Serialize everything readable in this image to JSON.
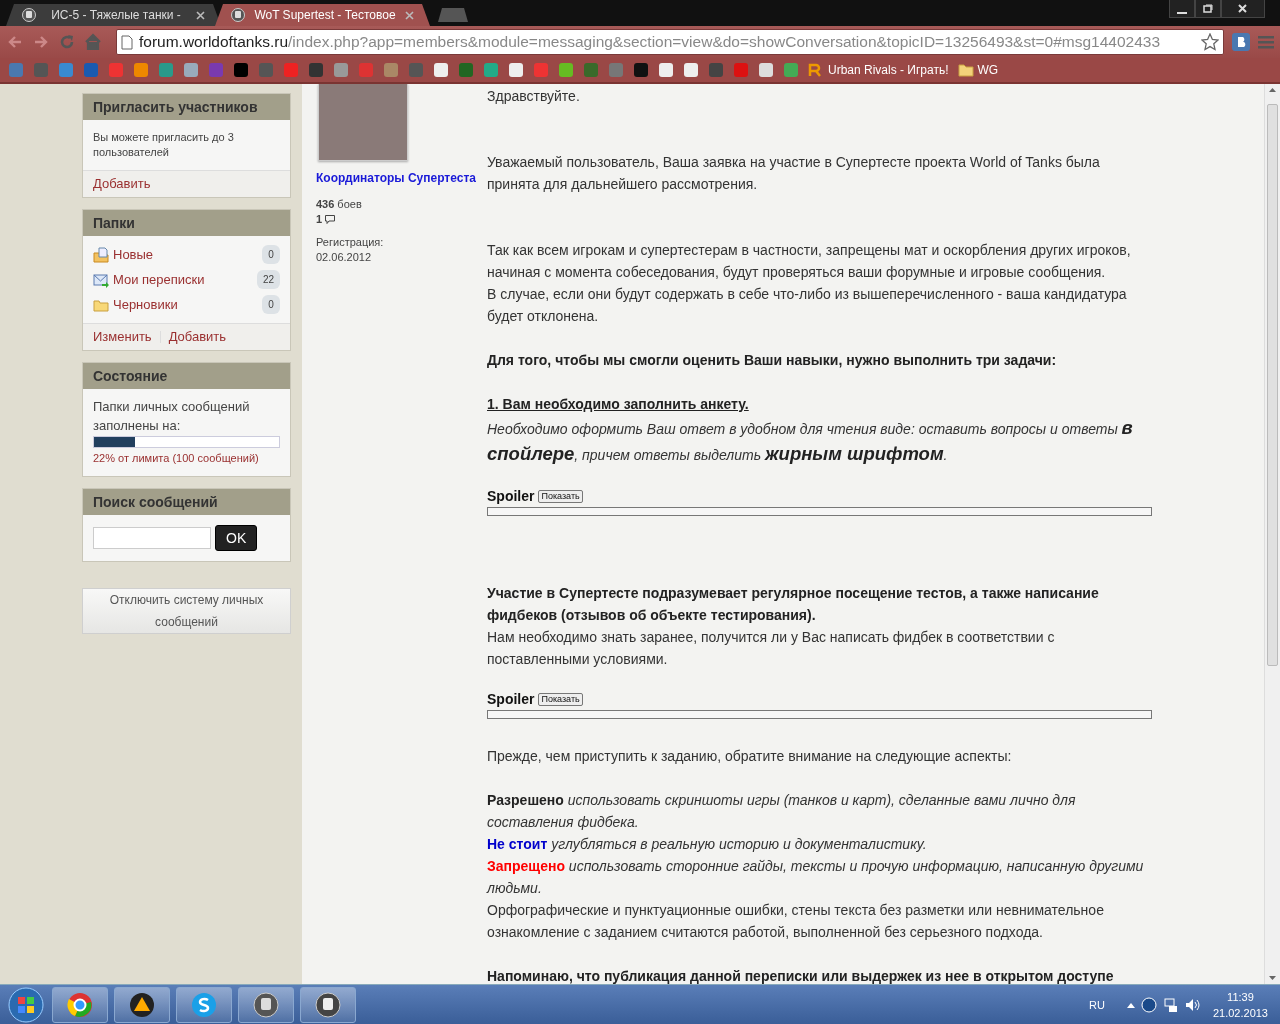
{
  "browser": {
    "tabs": [
      {
        "title": "ИС-5 - Тяжелые танки -",
        "selected": false
      },
      {
        "title": "WoT Supertest - Тестовое",
        "selected": true
      }
    ],
    "url": {
      "host": "forum.worldoftanks.ru",
      "path": "/index.php?app=members&module=messaging&section=view&do=showConversation&topicID=13256493&st=0#msg14402433"
    },
    "bookmarks": [
      {
        "label": "Urban Rivals - Играть!",
        "kind": "site"
      },
      {
        "label": "WG",
        "kind": "folder"
      }
    ]
  },
  "sidebar": {
    "invite": {
      "title": "Пригласить участников",
      "text": "Вы можете пригласить до 3 пользователей",
      "link": "Добавить"
    },
    "folders": {
      "title": "Папки",
      "items": [
        {
          "label": "Новые",
          "count": "0",
          "kind": "new"
        },
        {
          "label": "Мои переписки",
          "count": "22",
          "kind": "conversations"
        },
        {
          "label": "Черновики",
          "count": "0",
          "kind": "drafts"
        }
      ],
      "links": [
        "Изменить",
        "Добавить"
      ]
    },
    "status": {
      "title": "Состояние",
      "text": "Папки личных сообщений заполнены на:",
      "level": 0.22,
      "caption": "22% от лимита (100 сообщений)"
    },
    "search": {
      "title": "Поиск сообщений",
      "button": "OK"
    },
    "disable_button": "Отключить систему личных сообщений"
  },
  "author": {
    "group": "Координаторы Супертеста",
    "battles": "436",
    "battles_label": "боев",
    "posts": "1",
    "reg_label": "Регистрация:",
    "reg_date": "02.06.2012"
  },
  "message": {
    "blocks": [
      {
        "kind": "para",
        "lines": [
          [
            {
              "text": "Здравствуйте.",
              "kind": "plain"
            }
          ]
        ]
      },
      {
        "kind": "para",
        "lines": [
          [
            {
              "text": "Уважаемый пользователь, Ваша заявка на участие в Супертесте проекта World of Tanks была принята для дальнейшего рассмотрения.",
              "kind": "plain"
            }
          ]
        ]
      },
      {
        "kind": "para",
        "lines": [
          [
            {
              "text": "Так как всем игрокам и супертестерам в частности, запрещены мат и оскорбления других игроков, начиная с момента собеседования, будут проверяться ваши форумные и игровые сообщения.",
              "kind": "plain"
            }
          ],
          [
            {
              "text": "В случае, если они будут содержать в себе что-либо из вышеперечисленного - ваша кандидатура будет отклонена.",
              "kind": "plain"
            }
          ]
        ]
      },
      {
        "kind": "para",
        "lines": [
          [
            {
              "text": "Для того, чтобы мы смогли оценить Ваши навыки, нужно выполнить три задачи:",
              "kind": "bold"
            }
          ]
        ]
      },
      {
        "kind": "heading",
        "text": "1. Вам необходимо заполнить анкету."
      },
      {
        "kind": "para",
        "lines": [
          [
            {
              "text": "Необходимо оформить Ваш ответ в удобном для чтения виде: оставить вопросы и ответы ",
              "kind": "italic"
            },
            {
              "text": "в спойлере",
              "kind": "big"
            },
            {
              "text": ", причем ответы выделить ",
              "kind": "italic"
            },
            {
              "text": "жирным шрифтом",
              "kind": "big"
            },
            {
              "text": ".",
              "kind": "italic"
            }
          ]
        ]
      },
      {
        "kind": "spoiler",
        "label": "Spoiler",
        "button": "Показать"
      },
      {
        "kind": "para",
        "lines": [
          [
            {
              "text": "Участие в Супертесте подразумевает регулярное посещение тестов, а также написание фидбеков (отзывов об объекте тестирования).",
              "kind": "bold"
            }
          ],
          [
            {
              "text": "Нам необходимо знать заранее, получится ли у Вас написать фидбек в соответствии с поставленными условиями.",
              "kind": "plain"
            }
          ]
        ]
      },
      {
        "kind": "spoiler",
        "label": "Spoiler",
        "button": "Показать"
      },
      {
        "kind": "para",
        "lines": [
          [
            {
              "text": "Прежде, чем приступить к заданию, обратите внимание на следующие аспекты:",
              "kind": "plain"
            }
          ]
        ]
      },
      {
        "kind": "para",
        "lines": [
          [
            {
              "text": "Разрешено",
              "kind": "bold"
            },
            {
              "text": " использовать скриншоты игры (танков и карт), сделанные вами лично для составления фидбека.",
              "kind": "italic"
            }
          ],
          [
            {
              "text": "Не стоит",
              "kind": "bold",
              "color": "#0000cc"
            },
            {
              "text": " углубляться в реальную историю и документалистику.",
              "kind": "italic"
            }
          ],
          [
            {
              "text": "Запрещено",
              "kind": "bold",
              "color": "#ff0000"
            },
            {
              "text": " использовать сторонние гайды, тексты и прочую информацию, написанную другими людьми.",
              "kind": "italic"
            }
          ],
          [
            {
              "text": "Орфографические и пунктуационные ошибки, стены текста без разметки или невнимательное ознакомление с заданием считаются работой, выполненной без серьезного подхода.",
              "kind": "plain"
            }
          ]
        ]
      },
      {
        "kind": "para",
        "lines": [
          [
            {
              "text": "Напоминаю, что публикация данной переписки или выдержек из нее в открытом доступе",
              "kind": "bold"
            }
          ]
        ]
      }
    ]
  },
  "taskbar": {
    "lang": "RU",
    "time": "11:39",
    "date": "21.02.2013"
  }
}
